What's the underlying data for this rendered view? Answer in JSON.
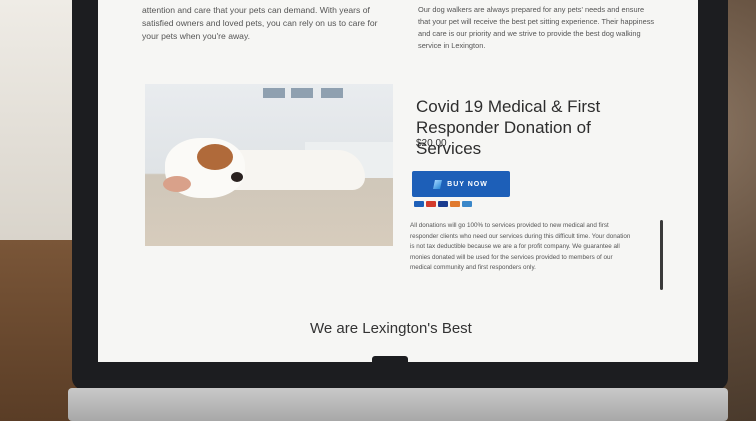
{
  "intro_left": "attention and care that your pets can demand. With years of satisfied owners and loved pets, you can rely on us to care for your pets when you're away.",
  "intro_right": "Our dog walkers are always prepared for any pets' needs and ensure that your pet will receive the best pet sitting experience. Their happiness and care is our priority and we strive to provide the best dog walking service in Lexington.",
  "product": {
    "title": "Covid 19 Medical & First Responder Donation of Services",
    "price": "$20.00",
    "buy_label": "BUY NOW",
    "description": "All donations will go 100% to services provided to new medical and first responder clients who need our services during this difficult time. Your donation is not tax deductible because we are a for profit company. We guarantee all monies donated will be used for the services provided to members of our medical community and first responders only."
  },
  "section_heading": "We are Lexington's Best",
  "cards": [
    {
      "icon": "paypal-icon",
      "color": "#1d5fb8"
    },
    {
      "icon": "mastercard-icon",
      "color": "#d33b2c"
    },
    {
      "icon": "visa-icon",
      "color": "#1a3c8f"
    },
    {
      "icon": "discover-icon",
      "color": "#e07a2f"
    },
    {
      "icon": "amex-icon",
      "color": "#3a87c9"
    }
  ],
  "colors": {
    "button": "#1d5fb8",
    "screen_bg": "#f6f6f4"
  }
}
